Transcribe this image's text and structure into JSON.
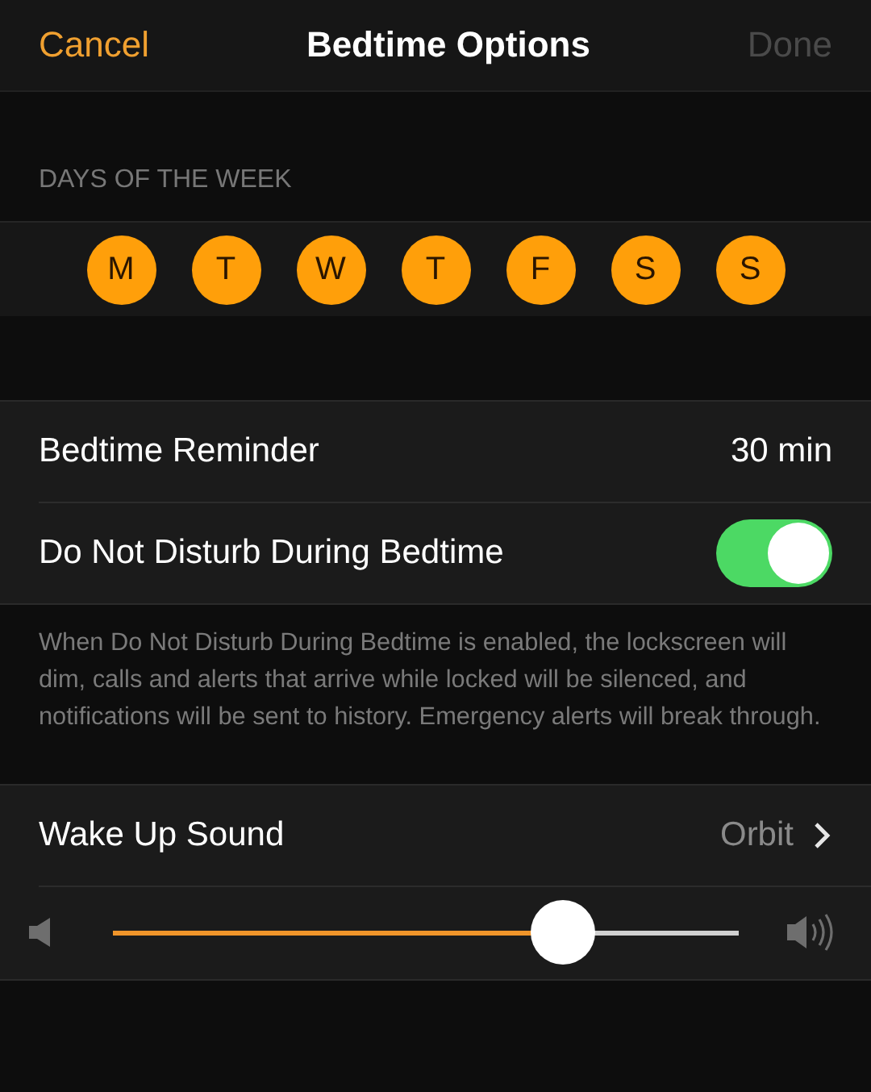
{
  "nav": {
    "cancel": "Cancel",
    "title": "Bedtime Options",
    "done": {
      "label": "Done",
      "disabled": true
    }
  },
  "days": {
    "header": "DAYS OF THE WEEK",
    "items": [
      {
        "label": "M",
        "selected": true
      },
      {
        "label": "T",
        "selected": true
      },
      {
        "label": "W",
        "selected": true
      },
      {
        "label": "T",
        "selected": true
      },
      {
        "label": "F",
        "selected": true
      },
      {
        "label": "S",
        "selected": true
      },
      {
        "label": "S",
        "selected": true
      }
    ]
  },
  "settings": [
    {
      "kind": "value",
      "label": "Bedtime Reminder",
      "value": "30 min"
    },
    {
      "kind": "toggle",
      "label": "Do Not Disturb During Bedtime",
      "on": true
    }
  ],
  "footer": "When Do Not Disturb During Bedtime is enabled, the lockscreen will dim, calls and alerts that arrive while locked will be silenced, and notifications will be sent to history. Emergency alerts will break through.",
  "sound": {
    "label": "Wake Up Sound",
    "value": "Orbit",
    "volume": {
      "level": 0.72
    }
  }
}
